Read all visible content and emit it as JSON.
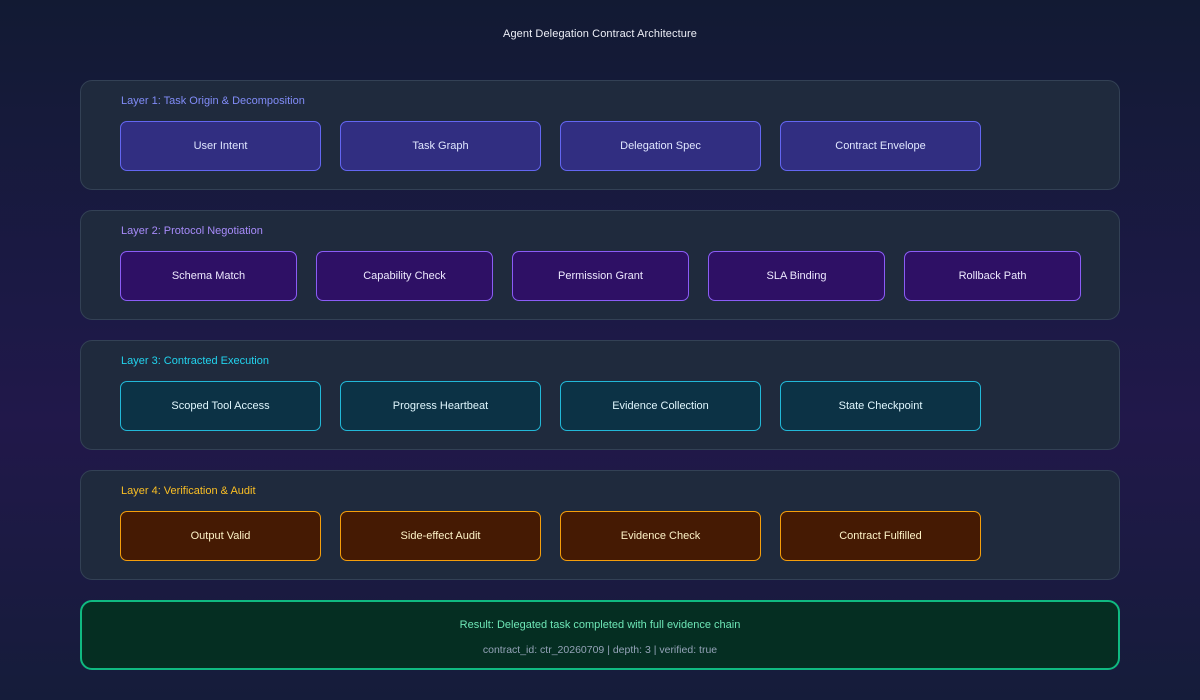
{
  "title": "Agent Delegation Contract Architecture",
  "layers": [
    {
      "label": "Layer 1: Task Origin & Decomposition",
      "accent": "#6366f1",
      "nodes": [
        "User Intent",
        "Task Graph",
        "Delegation Spec",
        "Contract Envelope"
      ]
    },
    {
      "label": "Layer 2: Protocol Negotiation",
      "accent": "#8b5cf6",
      "nodes": [
        "Schema Match",
        "Capability Check",
        "Permission Grant",
        "SLA Binding",
        "Rollback Path"
      ]
    },
    {
      "label": "Layer 3: Contracted Execution",
      "accent": "#22d3ee",
      "nodes": [
        "Scoped Tool Access",
        "Progress Heartbeat",
        "Evidence Collection",
        "State Checkpoint"
      ]
    },
    {
      "label": "Layer 4: Verification & Audit",
      "accent": "#f59e0b",
      "nodes": [
        "Output Valid",
        "Side-effect Audit",
        "Evidence Check",
        "Contract Fulfilled"
      ]
    }
  ],
  "result": {
    "text": "Result: Delegated task completed with full evidence chain",
    "meta": "contract_id: ctr_20260709 | depth: 3 | verified: true",
    "accent": "#10b981"
  }
}
